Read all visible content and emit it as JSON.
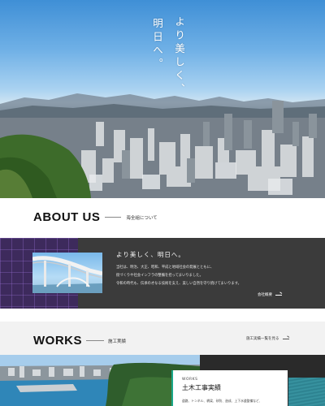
{
  "hero": {
    "copy_line1": "より美しく、",
    "copy_line2": "明日へ。"
  },
  "about": {
    "heading_en": "ABOUT US",
    "heading_ja": "海全組について",
    "title": "より美しく、明日へ。",
    "paragraph": [
      "当社は、明治、大正、昭和、平成と地域社会の発展とともに、",
      "街づくりや社会インフラの整備を担ってまいりました。",
      "令和の時代も、伝承の才なる技術を支え、美しい自然を守り続けてまいります。"
    ],
    "link_label": "会社概要"
  },
  "works": {
    "heading_en": "WORKS",
    "heading_ja": "施工実績",
    "link_label": "施工実績一覧を見る",
    "card_label": "WORKS",
    "card_title": "土木工事実績",
    "card_text": "道路、トンネル、橋梁、砂防、造成、上下水道整備など、"
  },
  "colors": {
    "accent_green": "#19a88a",
    "about_band": "#3b3b3b",
    "about_purple": "#3d2a5c"
  }
}
